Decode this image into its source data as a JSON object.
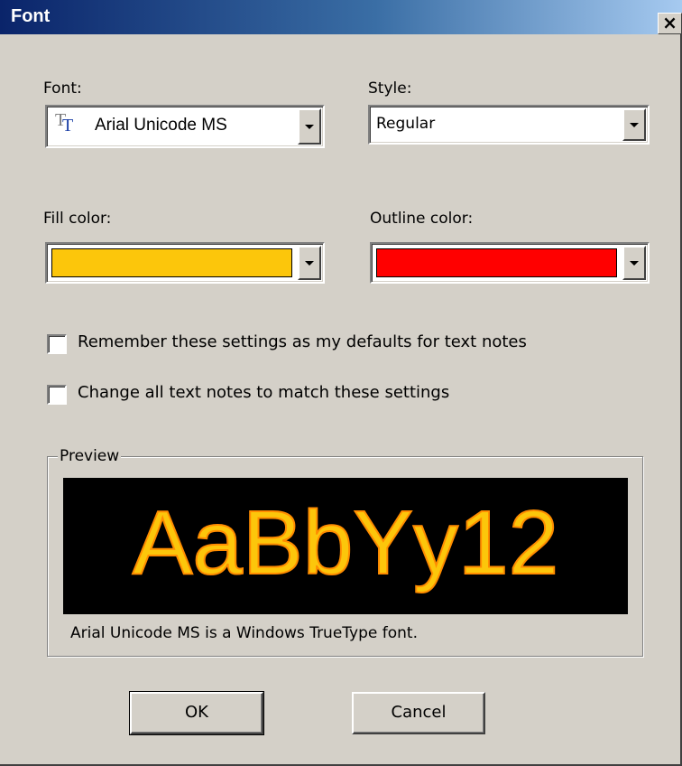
{
  "window": {
    "title": "Font",
    "close_glyph": "×"
  },
  "font_field": {
    "label": "Font:",
    "value": "Arial Unicode MS",
    "icon": "truetype-font-icon"
  },
  "style_field": {
    "label": "Style:",
    "value": "Regular"
  },
  "fill_color": {
    "label": "Fill color:",
    "color": "#fcc60b"
  },
  "outline_color": {
    "label": "Outline color:",
    "color": "#ff0000"
  },
  "options": {
    "remember_defaults": {
      "label": "Remember these settings as my defaults for text notes",
      "checked": false
    },
    "change_all": {
      "label": "Change all text notes to match these settings",
      "checked": false
    }
  },
  "preview": {
    "group_label": "Preview",
    "sample_text": "AaBbYy12",
    "description": "Arial Unicode MS is a Windows TrueType font.",
    "background": "#000000"
  },
  "buttons": {
    "ok": "OK",
    "cancel": "Cancel"
  }
}
